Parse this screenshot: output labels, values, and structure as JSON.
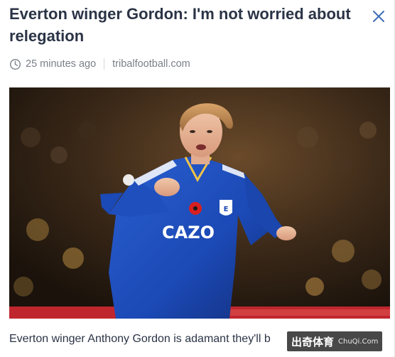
{
  "article": {
    "title": "Everton winger Gordon: I'm not worried about relegation",
    "time_ago": "25 minutes ago",
    "source": "tribalfootball.com",
    "lede": "Everton winger Anthony Gordon is adamant they'll b",
    "image_alt": "Anthony Gordon in Everton kit"
  },
  "shirt": {
    "sponsor": "CAZO",
    "badge_letter": "E"
  },
  "watermark": {
    "brand": "出奇体育",
    "domain": "ChuQi.Com"
  },
  "icons": {
    "close": "close-icon",
    "clock": "clock-icon"
  },
  "colors": {
    "title": "#2b3446",
    "meta": "#7a7f87",
    "close": "#3f6fb8",
    "kit_blue": "#1b49b5"
  }
}
